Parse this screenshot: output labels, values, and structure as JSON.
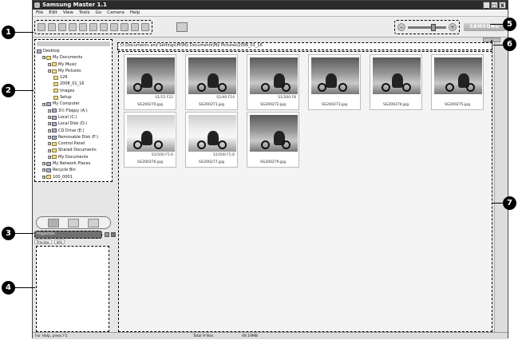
{
  "window": {
    "title": "Samsung Master 1.1",
    "controls": [
      "_",
      "□",
      "X"
    ]
  },
  "menu": [
    "File",
    "Edit",
    "View",
    "Tools",
    "Go",
    "Camera",
    "Help"
  ],
  "toolbar": {
    "icons": [
      "open-icon",
      "save-icon",
      "copy-icon",
      "undo-icon",
      "redo-icon",
      "cut-icon",
      "paste-icon",
      "print-icon",
      "email-icon",
      "slideshow-icon",
      "properties-icon"
    ],
    "zoom_level": 0.6,
    "brand": "SAMSUNG"
  },
  "tree": {
    "items": [
      {
        "label": "Desktop",
        "depth": 0,
        "icon": "desktop-icon"
      },
      {
        "label": "My Documents",
        "depth": 1,
        "icon": "folder-icon"
      },
      {
        "label": "My Music",
        "depth": 2,
        "icon": "folder-icon"
      },
      {
        "label": "My Pictures",
        "depth": 2,
        "icon": "folder-icon"
      },
      {
        "label": "126",
        "depth": 3,
        "icon": "folder-icon"
      },
      {
        "label": "2008_01_16",
        "depth": 3,
        "icon": "folder-icon"
      },
      {
        "label": "Images",
        "depth": 3,
        "icon": "folder-icon"
      },
      {
        "label": "Setup",
        "depth": 3,
        "icon": "folder-icon"
      },
      {
        "label": "My Computer",
        "depth": 1,
        "icon": "computer-icon"
      },
      {
        "label": "3½ Floppy (A:)",
        "depth": 2,
        "icon": "floppy-icon"
      },
      {
        "label": "Local (C:)",
        "depth": 2,
        "icon": "drive-icon"
      },
      {
        "label": "Local Disk (D:)",
        "depth": 2,
        "icon": "drive-icon"
      },
      {
        "label": "CD Drive (E:)",
        "depth": 2,
        "icon": "cd-icon"
      },
      {
        "label": "Removable Disk (F:)",
        "depth": 2,
        "icon": "drive-icon"
      },
      {
        "label": "Control Panel",
        "depth": 2,
        "icon": "folder-icon"
      },
      {
        "label": "Shared Documents",
        "depth": 2,
        "icon": "folder-icon"
      },
      {
        "label": "My Documents",
        "depth": 2,
        "icon": "folder-icon"
      },
      {
        "label": "My Network Places",
        "depth": 1,
        "icon": "network-icon"
      },
      {
        "label": "Recycle Bin",
        "depth": 1,
        "icon": "recycle-icon"
      },
      {
        "label": "100_0001",
        "depth": 1,
        "icon": "folder-icon"
      }
    ]
  },
  "file_info": {
    "bar_label": "Properties",
    "tabs": [
      "Preview",
      "Info"
    ]
  },
  "path": "D:\\Documents and Settings\\Ht\\My Documents\\My Pictures\\2008_01_16",
  "thumbnails": [
    {
      "name": "SG200270.jpg",
      "exif": "S1/15 F22",
      "light": false
    },
    {
      "name": "SG200271.jpg",
      "exif": "S1/40 F14",
      "light": false
    },
    {
      "name": "SG200272.jpg",
      "exif": "S1/200 F8",
      "light": false
    },
    {
      "name": "SG200273.jpg",
      "exif": "",
      "light": false
    },
    {
      "name": "SG200274.jpg",
      "exif": "",
      "light": false
    },
    {
      "name": "SG200275.jpg",
      "exif": "",
      "light": false
    },
    {
      "name": "SG200276.jpg",
      "exif": "S1/500 F5.6",
      "light": true
    },
    {
      "name": "SG200277.jpg",
      "exif": "S1/500 F5.6",
      "light": true
    },
    {
      "name": "SG200279.jpg",
      "exif": "",
      "light": false
    }
  ],
  "status": {
    "help": "For Help, press F1",
    "total": "Total 9 files",
    "size": "49.19MB"
  },
  "callouts": [
    "1",
    "2",
    "3",
    "4",
    "5",
    "6",
    "7"
  ]
}
